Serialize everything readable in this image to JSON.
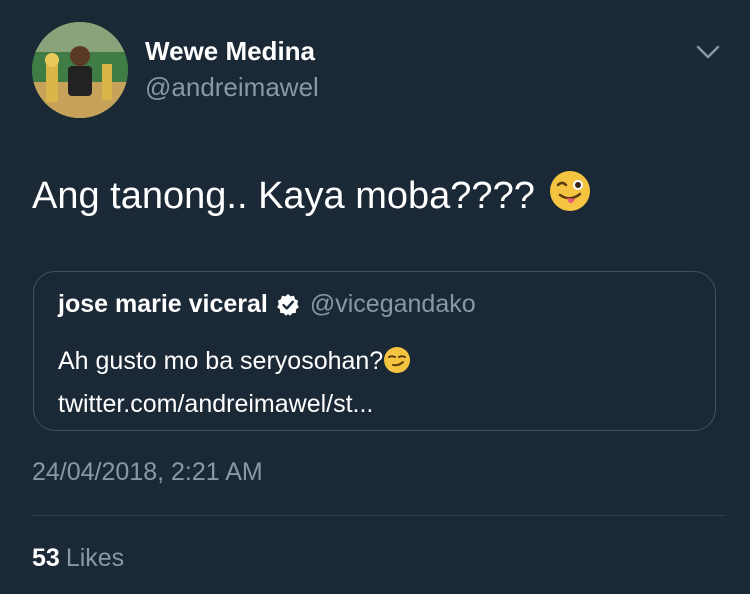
{
  "author": {
    "display_name": "Wewe Medina",
    "handle": "@andreimawel"
  },
  "tweet": {
    "text": "Ang tanong.. Kaya moba????",
    "emoji": "winking-face-with-tongue"
  },
  "quoted_tweet": {
    "display_name": "jose marie viceral",
    "verified": true,
    "handle": "@vicegandako",
    "text_before_emoji": "Ah gusto mo ba seryosohan?",
    "emoji": "smirking-face",
    "text_after_emoji": " twitter.com/andreimawel/st..."
  },
  "timestamp": "24/04/2018, 2:21 AM",
  "stats": {
    "likes_count": "53",
    "likes_label": "Likes"
  },
  "colors": {
    "background": "#1b2836",
    "secondary_text": "#8899a6",
    "border": "#3d5466"
  }
}
